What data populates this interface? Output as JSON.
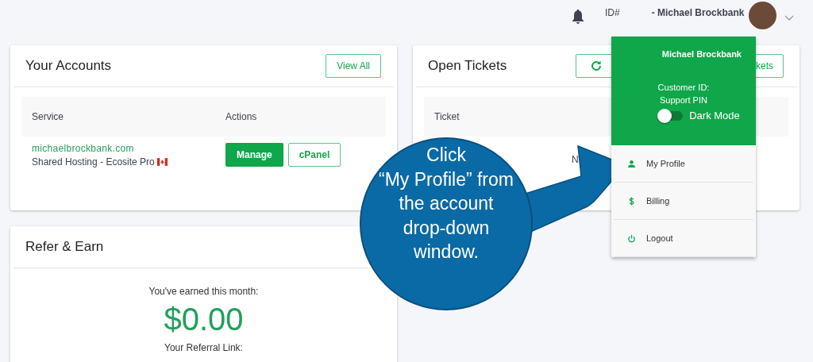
{
  "header": {
    "id_label": "ID#",
    "user_name": "- Michael Brockbank"
  },
  "accounts": {
    "title": "Your Accounts",
    "view_all": "View All",
    "columns": [
      "Service",
      "Actions"
    ],
    "rows": [
      {
        "domain": "michaelbrockbank.com",
        "plan": "Shared Hosting - Ecosite Pro",
        "buttons": [
          {
            "label": "Manage",
            "kind": "primary"
          },
          {
            "label": "cPanel",
            "kind": "outline"
          }
        ]
      }
    ]
  },
  "tickets": {
    "title": "Open Tickets",
    "view_all": "kets",
    "columns": [
      "Ticket"
    ],
    "empty": "N"
  },
  "refer": {
    "title": "Refer & Earn",
    "earned_label": "You've earned this month:",
    "amount": "$0.00",
    "link_label": "Your Referral Link:"
  },
  "dropdown": {
    "name": "Michael Brockbank",
    "customer_id": "Customer ID:",
    "support_pin": "Support PIN",
    "dark_mode": {
      "label": "Dark Mode",
      "on": false
    },
    "items": [
      {
        "label": "My Profile",
        "kind": "profile"
      },
      {
        "label": "Billing",
        "kind": "billing"
      },
      {
        "label": "Logout",
        "kind": "logout"
      }
    ]
  },
  "callout": {
    "lines": [
      "Click",
      "“My Profile” from",
      "the account",
      "drop-down",
      "window."
    ]
  }
}
